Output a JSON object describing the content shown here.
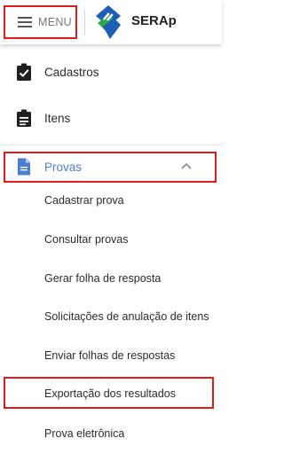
{
  "header": {
    "menu_label": "MENU",
    "brand": "SERAp"
  },
  "nav": {
    "cadastros": "Cadastros",
    "itens": "Itens",
    "provas": "Provas"
  },
  "provas_submenu": [
    "Cadastrar prova",
    "Consultar provas",
    "Gerar folha de resposta",
    "Solicitações de anulação de itens",
    "Enviar folhas de respostas",
    "Exportação dos resultados",
    "Prova eletrônica"
  ],
  "colors": {
    "highlight_border": "#e01b1b",
    "active_item": "#4a7fd0",
    "logo_blue": "#1e5fb6",
    "logo_green": "#2ea84a"
  },
  "icons": {
    "menu": "hamburger-icon",
    "cadastros": "clipboard-check-icon",
    "itens": "clipboard-list-icon",
    "provas": "document-icon",
    "provas_toggle": "chevron-up-icon"
  }
}
